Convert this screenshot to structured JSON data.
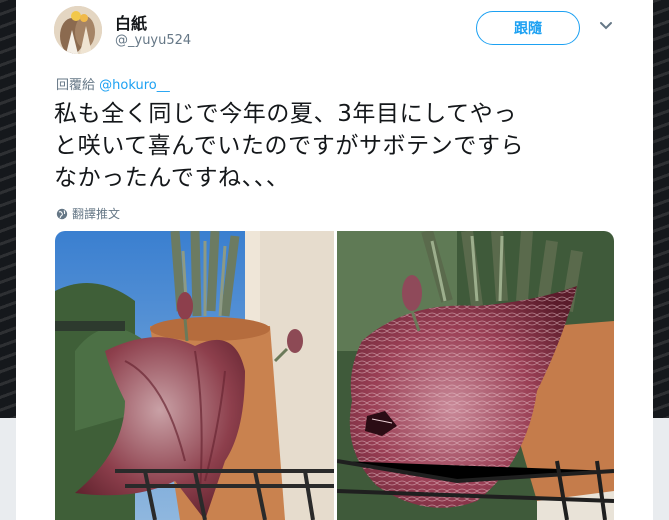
{
  "tweet": {
    "display_name": "白紙",
    "handle": "@_yuyu524",
    "follow_label": "跟隨",
    "reply_prefix": "回覆給",
    "reply_mention": "@hokuro__",
    "text_lines": [
      "私も全く同じで今年の夏、3年目にしてやっ",
      "と咲いて喜んでいたのですがサボテンですら",
      "なかったんですね、、、"
    ],
    "translate_label": "翻譯推文"
  },
  "icons": {
    "more": "chevron-down-icon",
    "translate": "globe-icon"
  },
  "colors": {
    "accent": "#1da1f2",
    "text": "#14171a",
    "muted": "#657786"
  }
}
